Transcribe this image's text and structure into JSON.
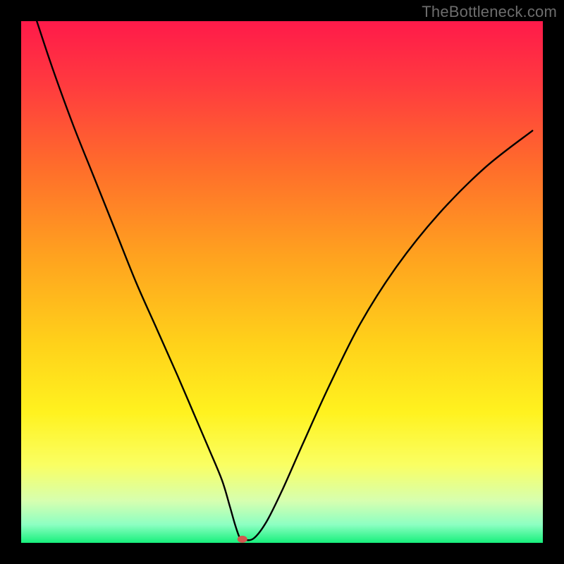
{
  "watermark": "TheBottleneck.com",
  "chart_data": {
    "type": "line",
    "title": "",
    "xlabel": "",
    "ylabel": "",
    "xlim": [
      0,
      100
    ],
    "ylim": [
      0,
      100
    ],
    "series": [
      {
        "name": "curve",
        "x": [
          3,
          6,
          10,
          14,
          18,
          22,
          26,
          30,
          33,
          36,
          38.5,
          40,
          41,
          41.8,
          42.4,
          44.5,
          47,
          50,
          54,
          59,
          65,
          72,
          80,
          89,
          98
        ],
        "y": [
          100,
          91,
          80,
          70,
          60,
          50,
          41,
          32,
          25,
          18,
          12,
          7,
          3.5,
          1.2,
          0.7,
          0.8,
          4,
          10,
          19,
          30,
          42,
          53,
          63,
          72,
          79
        ]
      }
    ],
    "background_gradient": {
      "stops": [
        {
          "pos": 0.0,
          "color": "#ff1a4a"
        },
        {
          "pos": 0.12,
          "color": "#ff3a3f"
        },
        {
          "pos": 0.28,
          "color": "#ff6d2b"
        },
        {
          "pos": 0.45,
          "color": "#ffa21f"
        },
        {
          "pos": 0.62,
          "color": "#ffd21a"
        },
        {
          "pos": 0.75,
          "color": "#fff21f"
        },
        {
          "pos": 0.85,
          "color": "#faff62"
        },
        {
          "pos": 0.92,
          "color": "#d6ffb0"
        },
        {
          "pos": 0.965,
          "color": "#8dffc2"
        },
        {
          "pos": 1.0,
          "color": "#17f07c"
        }
      ]
    },
    "marker": {
      "x": 42.4,
      "y": 0.7,
      "color": "#d2574e",
      "rx": 7,
      "ry": 5
    }
  }
}
